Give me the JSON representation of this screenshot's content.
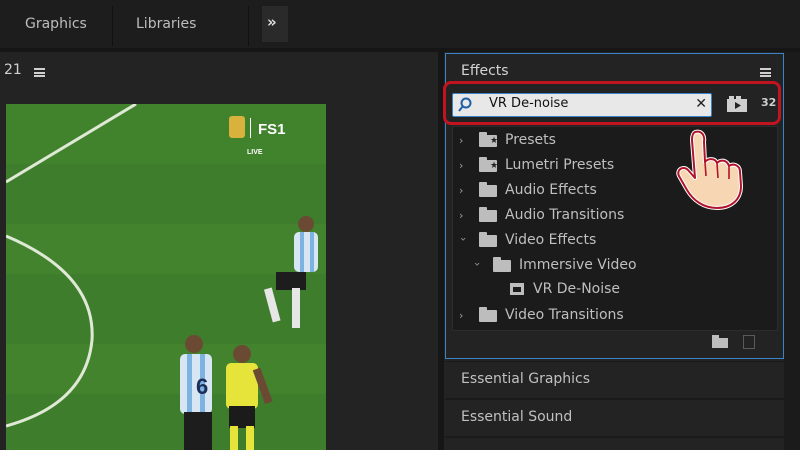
{
  "topbar": {
    "tabs": [
      "Graphics",
      "Libraries"
    ],
    "overflow_label": "»"
  },
  "monitor": {
    "timecode": "21",
    "overlay": {
      "network_logo": "FS1",
      "live_label": "LIVE",
      "player_number": "6"
    }
  },
  "effects_panel": {
    "title": "Effects",
    "search": {
      "value": "VR De-noise",
      "clear_label": "✕"
    },
    "bin_icon_label": "32",
    "tree": [
      {
        "label": "Presets",
        "expanded": false,
        "icon": "folder-star-icon",
        "depth": 0
      },
      {
        "label": "Lumetri Presets",
        "expanded": false,
        "icon": "folder-star-icon",
        "depth": 0
      },
      {
        "label": "Audio Effects",
        "expanded": false,
        "icon": "folder-icon",
        "depth": 0
      },
      {
        "label": "Audio Transitions",
        "expanded": false,
        "icon": "folder-icon",
        "depth": 0
      },
      {
        "label": "Video Effects",
        "expanded": true,
        "icon": "folder-icon",
        "depth": 0
      },
      {
        "label": "Immersive Video",
        "expanded": true,
        "icon": "folder-icon",
        "depth": 1
      },
      {
        "label": "VR De-Noise",
        "icon": "effect-icon",
        "depth": 2
      },
      {
        "label": "Video Transitions",
        "expanded": false,
        "icon": "folder-icon",
        "depth": 0
      }
    ]
  },
  "collapsed_panels": [
    "Essential Graphics",
    "Essential Sound"
  ],
  "colors": {
    "accent": "#3b83c7",
    "highlight": "#c21420",
    "background": "#232323"
  }
}
